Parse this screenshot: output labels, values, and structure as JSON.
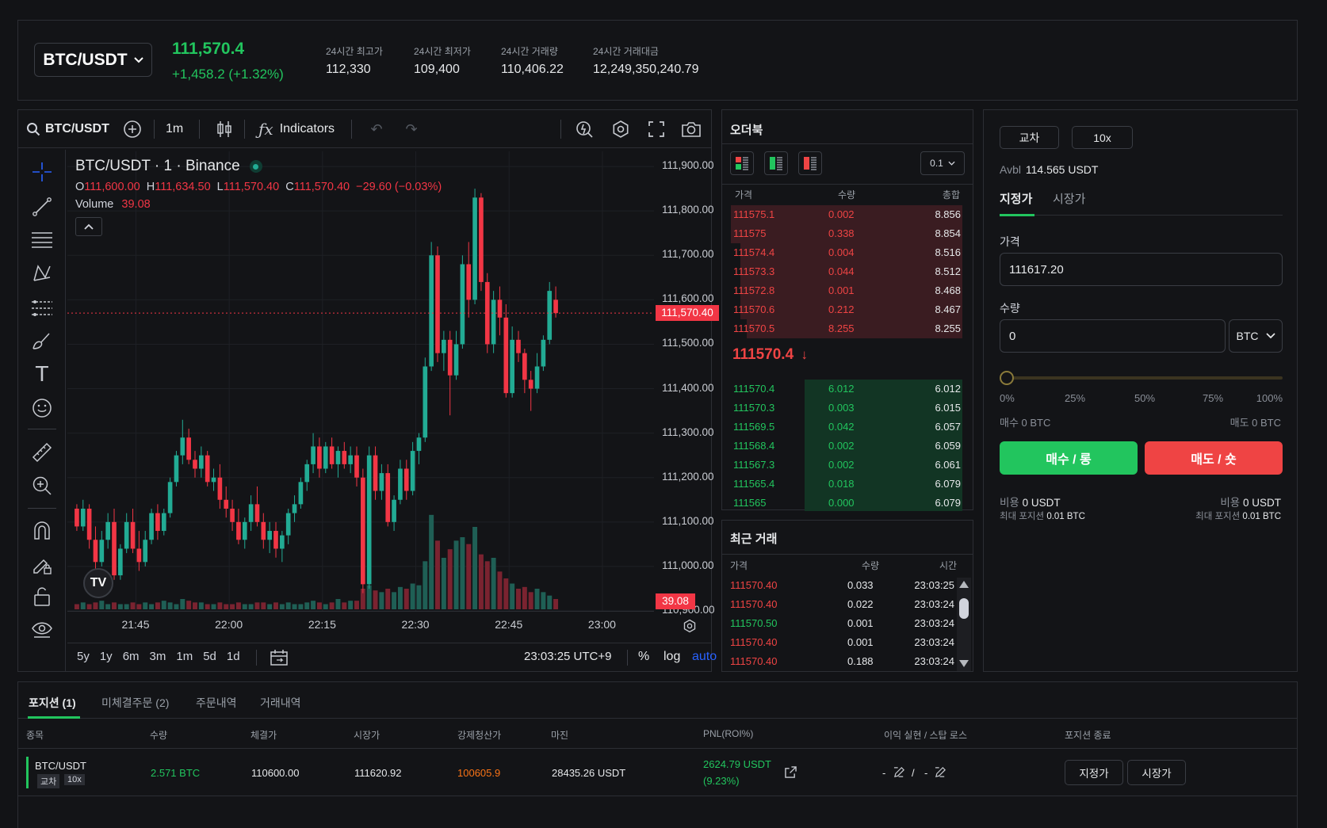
{
  "header": {
    "symbol": "BTC/USDT",
    "last_price": "111,570.4",
    "change": "+1,458.2 (+1.32%)",
    "stats": [
      {
        "label": "24시간 최고가",
        "value": "112,330"
      },
      {
        "label": "24시간 최저가",
        "value": "109,400"
      },
      {
        "label": "24시간 거래량",
        "value": "110,406.22"
      },
      {
        "label": "24시간 거래대금",
        "value": "12,249,350,240.79"
      }
    ]
  },
  "chart_toolbar": {
    "symbol": "BTC/USDT",
    "interval": "1m",
    "indicators": "Indicators"
  },
  "chart_legend": {
    "title": "BTC/USDT · 1 · Binance",
    "o_label": "O",
    "o": "111,600.00",
    "h_label": "H",
    "h": "111,634.50",
    "l_label": "L",
    "l": "111,570.40",
    "c_label": "C",
    "c": "111,570.40",
    "change": "−29.60 (−0.03%)",
    "volume_label": "Volume",
    "volume": "39.08"
  },
  "chart_data": {
    "type": "candlestick",
    "y_ticks": [
      "111,900.00",
      "111,800.00",
      "111,700.00",
      "111,600.00",
      "111,500.00",
      "111,400.00",
      "111,300.00",
      "111,200.00",
      "111,100.00",
      "111,000.00",
      "110,900.00"
    ],
    "ylim": [
      110900,
      111934
    ],
    "x_ticks": [
      "21:45",
      "22:00",
      "22:15",
      "22:30",
      "22:45",
      "23:00"
    ],
    "price_line": "111,570.40",
    "volume_tag": "39.08",
    "colors": {
      "up": "#22ab94",
      "down": "#f23645"
    },
    "candles": [
      [
        111130,
        111140,
        111080,
        111090
      ],
      [
        111090,
        111150,
        111080,
        111130
      ],
      [
        111130,
        111140,
        111040,
        111060
      ],
      [
        111060,
        111090,
        110990,
        111010
      ],
      [
        111010,
        111080,
        111000,
        111060
      ],
      [
        111060,
        111120,
        111040,
        111100
      ],
      [
        111100,
        111130,
        110970,
        110980
      ],
      [
        110980,
        111050,
        110970,
        111040
      ],
      [
        111040,
        111120,
        111030,
        111100
      ],
      [
        111100,
        111130,
        111030,
        111040
      ],
      [
        111040,
        111080,
        110990,
        111010
      ],
      [
        111010,
        111080,
        111000,
        111060
      ],
      [
        111060,
        111130,
        111050,
        111120
      ],
      [
        111120,
        111140,
        111060,
        111080
      ],
      [
        111080,
        111130,
        111070,
        111120
      ],
      [
        111120,
        111200,
        111110,
        111190
      ],
      [
        111190,
        111260,
        111180,
        111250
      ],
      [
        111250,
        111330,
        111230,
        111290
      ],
      [
        111290,
        111310,
        111230,
        111240
      ],
      [
        111240,
        111260,
        111200,
        111220
      ],
      [
        111220,
        111270,
        111200,
        111250
      ],
      [
        111250,
        111260,
        111180,
        111190
      ],
      [
        111190,
        111220,
        111170,
        111200
      ],
      [
        111200,
        111230,
        111130,
        111150
      ],
      [
        111150,
        111180,
        111110,
        111130
      ],
      [
        111130,
        111150,
        111080,
        111100
      ],
      [
        111100,
        111130,
        111050,
        111060
      ],
      [
        111060,
        111110,
        111040,
        111100
      ],
      [
        111100,
        111160,
        111080,
        111140
      ],
      [
        111140,
        111180,
        111090,
        111100
      ],
      [
        111100,
        111120,
        111040,
        111060
      ],
      [
        111060,
        111100,
        111030,
        111080
      ],
      [
        111080,
        111100,
        111020,
        111040
      ],
      [
        111040,
        111080,
        111010,
        111070
      ],
      [
        111070,
        111130,
        111050,
        111120
      ],
      [
        111120,
        111160,
        111100,
        111140
      ],
      [
        111140,
        111200,
        111130,
        111190
      ],
      [
        111190,
        111240,
        111170,
        111230
      ],
      [
        111230,
        111300,
        111210,
        111270
      ],
      [
        111270,
        111290,
        111200,
        111220
      ],
      [
        111220,
        111280,
        111210,
        111270
      ],
      [
        111270,
        111290,
        111220,
        111230
      ],
      [
        111230,
        111270,
        111200,
        111260
      ],
      [
        111260,
        111280,
        111220,
        111230
      ],
      [
        111230,
        111270,
        111210,
        111250
      ],
      [
        111250,
        111270,
        111180,
        111200
      ],
      [
        111200,
        111220,
        110940,
        110960
      ],
      [
        110960,
        111270,
        110950,
        111250
      ],
      [
        111250,
        111270,
        111150,
        111170
      ],
      [
        111170,
        111230,
        111150,
        111210
      ],
      [
        111210,
        111230,
        111090,
        111100
      ],
      [
        111100,
        111160,
        111080,
        111150
      ],
      [
        111150,
        111240,
        111140,
        111220
      ],
      [
        111220,
        111240,
        111150,
        111170
      ],
      [
        111170,
        111280,
        111160,
        111260
      ],
      [
        111260,
        111300,
        111230,
        111290
      ],
      [
        111290,
        111470,
        111280,
        111450
      ],
      [
        111450,
        111730,
        111440,
        111700
      ],
      [
        111700,
        111720,
        111460,
        111480
      ],
      [
        111480,
        111530,
        111440,
        111510
      ],
      [
        111510,
        111530,
        111340,
        111430
      ],
      [
        111430,
        111530,
        111420,
        111500
      ],
      [
        111500,
        111700,
        111490,
        111680
      ],
      [
        111680,
        111730,
        111560,
        111600
      ],
      [
        111600,
        111850,
        111590,
        111830
      ],
      [
        111830,
        111840,
        111620,
        111640
      ],
      [
        111640,
        111660,
        111480,
        111500
      ],
      [
        111500,
        111620,
        111480,
        111600
      ],
      [
        111600,
        111630,
        111520,
        111560
      ],
      [
        111560,
        111590,
        111380,
        111390
      ],
      [
        111390,
        111540,
        111380,
        111510
      ],
      [
        111510,
        111530,
        111460,
        111480
      ],
      [
        111480,
        111490,
        111390,
        111420
      ],
      [
        111420,
        111440,
        111350,
        111400
      ],
      [
        111400,
        111480,
        111390,
        111450
      ],
      [
        111450,
        111520,
        111440,
        111510
      ],
      [
        111510,
        111640,
        111500,
        111620
      ],
      [
        111600,
        111630,
        111560,
        111570
      ]
    ],
    "volumes": [
      3,
      4,
      3,
      4,
      5,
      3,
      4,
      3,
      3,
      4,
      3,
      4,
      3,
      4,
      5,
      4,
      3,
      6,
      5,
      4,
      4,
      3,
      3,
      4,
      3,
      3,
      4,
      3,
      3,
      4,
      4,
      3,
      4,
      3,
      4,
      3,
      3,
      4,
      5,
      4,
      3,
      4,
      6,
      4,
      5,
      5,
      12,
      14,
      11,
      10,
      12,
      10,
      13,
      12,
      15,
      14,
      28,
      55,
      40,
      30,
      35,
      40,
      42,
      38,
      48,
      32,
      28,
      30,
      22,
      18,
      15,
      12,
      13,
      10,
      12,
      10,
      8,
      6
    ],
    "range_buttons": [
      "5y",
      "1y",
      "6m",
      "3m",
      "1m",
      "5d",
      "1d"
    ],
    "clock": "23:03:25 UTC+9",
    "pct": "%",
    "log": "log",
    "auto": "auto"
  },
  "orderbook": {
    "title": "오더북",
    "precision": "0.1",
    "headers": [
      "가격",
      "수량",
      "총합"
    ],
    "asks": [
      [
        "111575.1",
        "0.002",
        "8.856"
      ],
      [
        "111575",
        "0.338",
        "8.854"
      ],
      [
        "111574.4",
        "0.004",
        "8.516"
      ],
      [
        "111573.3",
        "0.044",
        "8.512"
      ],
      [
        "111572.8",
        "0.001",
        "8.468"
      ],
      [
        "111570.6",
        "0.212",
        "8.467"
      ],
      [
        "111570.5",
        "8.255",
        "8.255"
      ]
    ],
    "ask_depth": [
      1.0,
      1.0,
      0.96,
      0.96,
      0.96,
      0.96,
      0.93
    ],
    "mid": "111570.4",
    "bids": [
      [
        "111570.4",
        "6.012",
        "6.012"
      ],
      [
        "111570.3",
        "0.003",
        "6.015"
      ],
      [
        "111569.5",
        "0.042",
        "6.057"
      ],
      [
        "111568.4",
        "0.002",
        "6.059"
      ],
      [
        "111567.3",
        "0.002",
        "6.061"
      ],
      [
        "111565.4",
        "0.018",
        "6.079"
      ],
      [
        "111565",
        "0.000",
        "6.079"
      ]
    ],
    "bid_depth": [
      0.68,
      0.68,
      0.68,
      0.68,
      0.68,
      0.68,
      0.68
    ]
  },
  "trades": {
    "title": "최근 거래",
    "headers": [
      "가격",
      "수량",
      "시간"
    ],
    "rows": [
      [
        "111570.40",
        "0.033",
        "23:03:25",
        "sell"
      ],
      [
        "111570.40",
        "0.022",
        "23:03:24",
        "sell"
      ],
      [
        "111570.50",
        "0.001",
        "23:03:24",
        "buy"
      ],
      [
        "111570.40",
        "0.001",
        "23:03:24",
        "sell"
      ],
      [
        "111570.40",
        "0.188",
        "23:03:24",
        "sell"
      ]
    ]
  },
  "order_form": {
    "margin_mode": "교차",
    "leverage": "10x",
    "avbl_label": "Avbl",
    "avbl": "114.565 USDT",
    "tabs": [
      "지정가",
      "시장가"
    ],
    "price_label": "가격",
    "price_value": "111617.20",
    "qty_label": "수량",
    "qty_value": "0",
    "qty_unit": "BTC",
    "slider_pct": 0,
    "slider_marks": [
      "0%",
      "25%",
      "50%",
      "75%",
      "100%"
    ],
    "buy_qty": "매수 0 BTC",
    "sell_qty": "매도 0 BTC",
    "buy_btn": "매수 / 롱",
    "sell_btn": "매도 / 숏",
    "cost_label": "비용",
    "buy_cost": "0 USDT",
    "sell_cost": "0 USDT",
    "max_label": "최대 포지션",
    "buy_max": "0.01 BTC",
    "sell_max": "0.01 BTC"
  },
  "positions": {
    "tabs": [
      "포지션 (1)",
      "미체결주문 (2)",
      "주문내역",
      "거래내역"
    ],
    "headers": [
      "종목",
      "수량",
      "체결가",
      "시장가",
      "강제청산가",
      "마진",
      "PNL(ROI%)",
      "이익 실현 / 스탑 로스",
      "포지션 종료"
    ],
    "row": {
      "symbol": "BTC/USDT",
      "mode": "교차",
      "lev": "10x",
      "qty": "2.571 BTC",
      "entry": "110600.00",
      "mark": "111620.92",
      "liq": "100605.9",
      "margin": "28435.26 USDT",
      "pnl": "2624.79 USDT",
      "roi": "(9.23%)",
      "tp": "-",
      "sep": "/",
      "sl": "-",
      "close_limit": "지정가",
      "close_market": "시장가"
    }
  }
}
